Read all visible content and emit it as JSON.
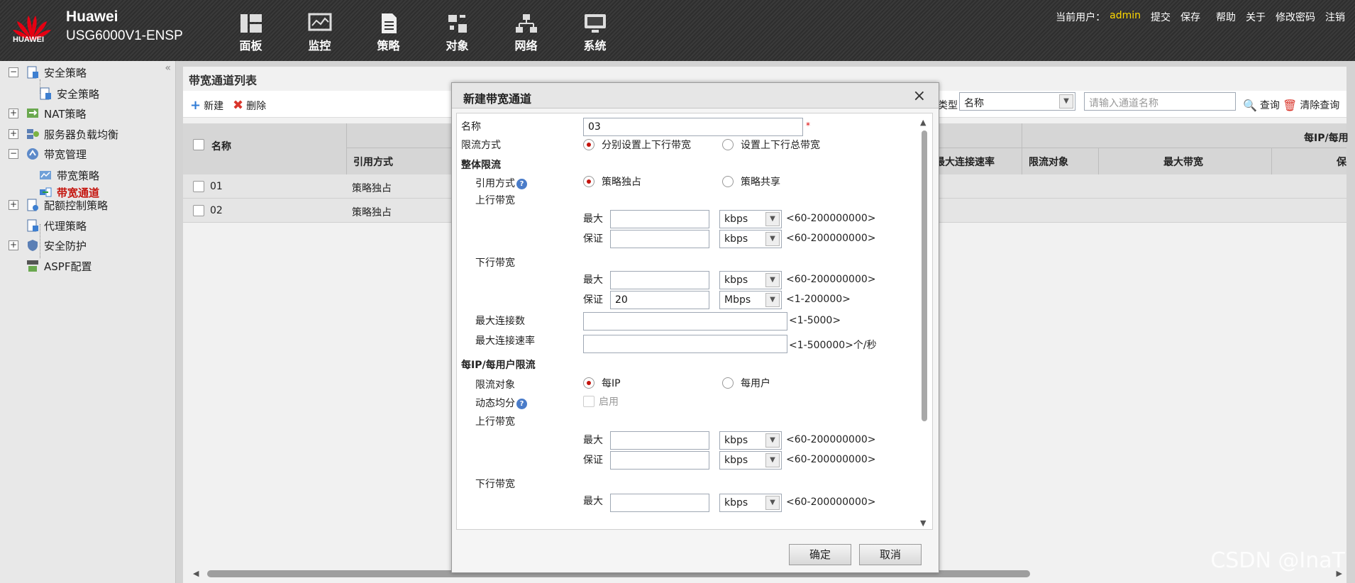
{
  "header": {
    "logo_text": "HUAWEI",
    "brand": "Huawei",
    "model": "USG6000V1-ENSP",
    "nav": [
      {
        "label": "面板",
        "icon": "dashboard-icon"
      },
      {
        "label": "监控",
        "icon": "monitor-icon"
      },
      {
        "label": "策略",
        "icon": "policy-icon"
      },
      {
        "label": "对象",
        "icon": "object-icon"
      },
      {
        "label": "网络",
        "icon": "network-icon"
      },
      {
        "label": "系统",
        "icon": "system-icon"
      }
    ],
    "current_user_label": "当前用户：",
    "username": "admin",
    "links": [
      "提交",
      "保存",
      "帮助",
      "关于",
      "修改密码",
      "注销"
    ]
  },
  "sidebar": {
    "items": [
      {
        "label": "安全策略"
      },
      {
        "label": "安全策略"
      },
      {
        "label": "NAT策略"
      },
      {
        "label": "服务器负载均衡"
      },
      {
        "label": "带宽管理"
      },
      {
        "label": "带宽策略"
      },
      {
        "label": "带宽通道"
      },
      {
        "label": "配额控制策略"
      },
      {
        "label": "代理策略"
      },
      {
        "label": "安全防护"
      },
      {
        "label": "ASPF配置"
      }
    ],
    "active_index": 6
  },
  "main": {
    "title": "带宽通道列表",
    "new_label": "新建",
    "delete_label": "删除",
    "filter_type_label": "类型",
    "filter_type_value": "名称",
    "search_placeholder": "请输入通道名称",
    "query_label": "查询",
    "clear_query_label": "清除查询",
    "columns": {
      "name": "名称",
      "ref": "引用方式",
      "max_conn_rate": "最大连接速率",
      "limit_target": "限流对象",
      "max_bw": "最大带宽",
      "per_ip": "每IP/每用",
      "trunc": "保"
    },
    "rows": [
      {
        "name": "01",
        "ref": "策略独占"
      },
      {
        "name": "02",
        "ref": "策略独占"
      }
    ]
  },
  "dialog": {
    "title": "新建带宽通道",
    "name_label": "名称",
    "name_value": "03",
    "required_mark": "*",
    "limit_mode_label": "限流方式",
    "limit_mode_options": [
      "分别设置上下行带宽",
      "设置上下行总带宽"
    ],
    "overall_section": "整体限流",
    "ref_mode_label": "引用方式",
    "ref_mode_options": [
      "策略独占",
      "策略共享"
    ],
    "upstream_label": "上行带宽",
    "downstream_label": "下行带宽",
    "max_label": "最大",
    "guarantee_label": "保证",
    "overall_up_max": {
      "value": "",
      "unit": "kbps",
      "hint": "<60-200000000>"
    },
    "overall_up_guarantee": {
      "value": "",
      "unit": "kbps",
      "hint": "<60-200000000>"
    },
    "overall_down_max": {
      "value": "",
      "unit": "kbps",
      "hint": "<60-200000000>"
    },
    "overall_down_guarantee": {
      "value": "20",
      "unit": "Mbps",
      "hint": "<1-200000>"
    },
    "max_conn_label": "最大连接数",
    "max_conn_hint": "<1-5000>",
    "max_conn_rate_label": "最大连接速率",
    "max_conn_rate_hint": "<1-500000>个/秒",
    "per_section": "每IP/每用户限流",
    "target_label": "限流对象",
    "target_options": [
      "每IP",
      "每用户"
    ],
    "dyn_label": "动态均分",
    "dyn_enable": "启用",
    "per_up_max": {
      "value": "",
      "unit": "kbps",
      "hint": "<60-200000000>"
    },
    "per_up_guarantee": {
      "value": "",
      "unit": "kbps",
      "hint": "<60-200000000>"
    },
    "per_down_max": {
      "value": "",
      "unit": "kbps",
      "hint": "<60-200000000>"
    },
    "ok_label": "确定",
    "cancel_label": "取消"
  },
  "watermark": "CSDN @InaT"
}
